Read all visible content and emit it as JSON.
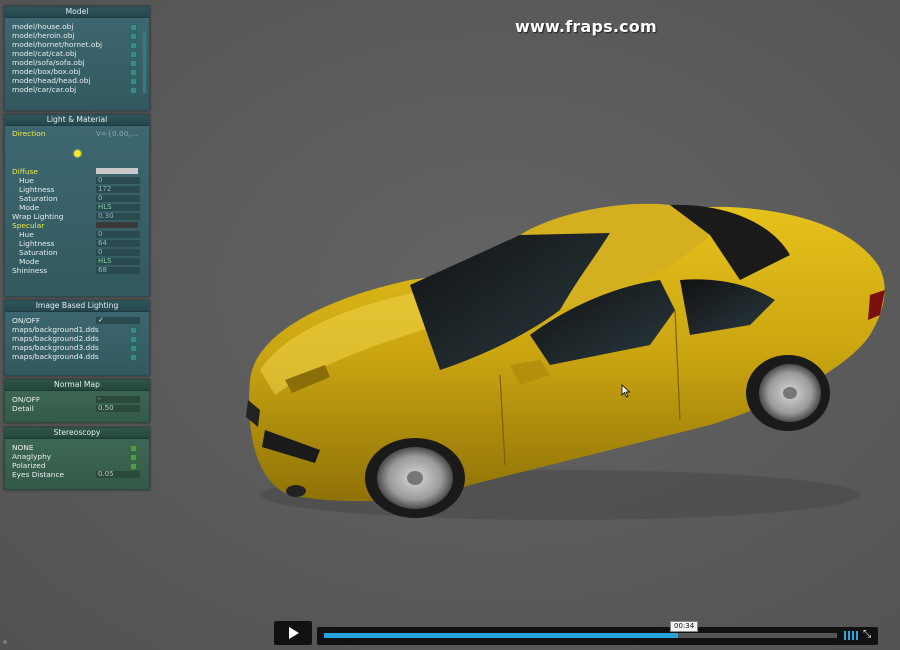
{
  "watermark": "www.fraps.com",
  "model_panel": {
    "title": "Model",
    "items": [
      "model/house.obj",
      "model/heroin.obj",
      "model/hornet/hornet.obj",
      "model/cat/cat.obj",
      "model/sofa/sofa.obj",
      "model/box/box.obj",
      "model/head/head.obj",
      "model/car/car.obj"
    ]
  },
  "light_panel": {
    "title": "Light & Material",
    "direction_label": "Direction",
    "direction_value": "V={0.00,...",
    "diffuse_label": "Diffuse",
    "diffuse_color": "#c8c8c8",
    "diffuse": {
      "hue_label": "Hue",
      "hue": "0",
      "lightness_label": "Lightness",
      "lightness": "172",
      "saturation_label": "Saturation",
      "saturation": "0",
      "mode_label": "Mode",
      "mode": "HLS"
    },
    "wrap_label": "Wrap Lighting",
    "wrap_value": "0.30",
    "specular_label": "Specular",
    "specular_color": "#3a3a3a",
    "specular": {
      "hue_label": "Hue",
      "hue": "0",
      "lightness_label": "Lightness",
      "lightness": "64",
      "saturation_label": "Saturation",
      "saturation": "0",
      "mode_label": "Mode",
      "mode": "HLS"
    },
    "shininess_label": "Shininess",
    "shininess_value": "68"
  },
  "ibl_panel": {
    "title": "Image Based Lighting",
    "onoff_label": "ON/OFF",
    "onoff_value": "✓",
    "items": [
      "maps/background1.dds",
      "maps/background2.dds",
      "maps/background3.dds",
      "maps/background4.dds"
    ]
  },
  "normal_panel": {
    "title": "Normal Map",
    "onoff_label": "ON/OFF",
    "onoff_value": "-",
    "detail_label": "Detail",
    "detail_value": "0.50"
  },
  "stereo_panel": {
    "title": "Stereoscopy",
    "items": [
      "NONE",
      "Anaglyphy",
      "Polarized"
    ],
    "eyes_label": "Eyes Distance",
    "eyes_value": "0.05"
  },
  "player": {
    "time": "00:34",
    "progress": 0.69,
    "accent": "#27a3dd"
  }
}
